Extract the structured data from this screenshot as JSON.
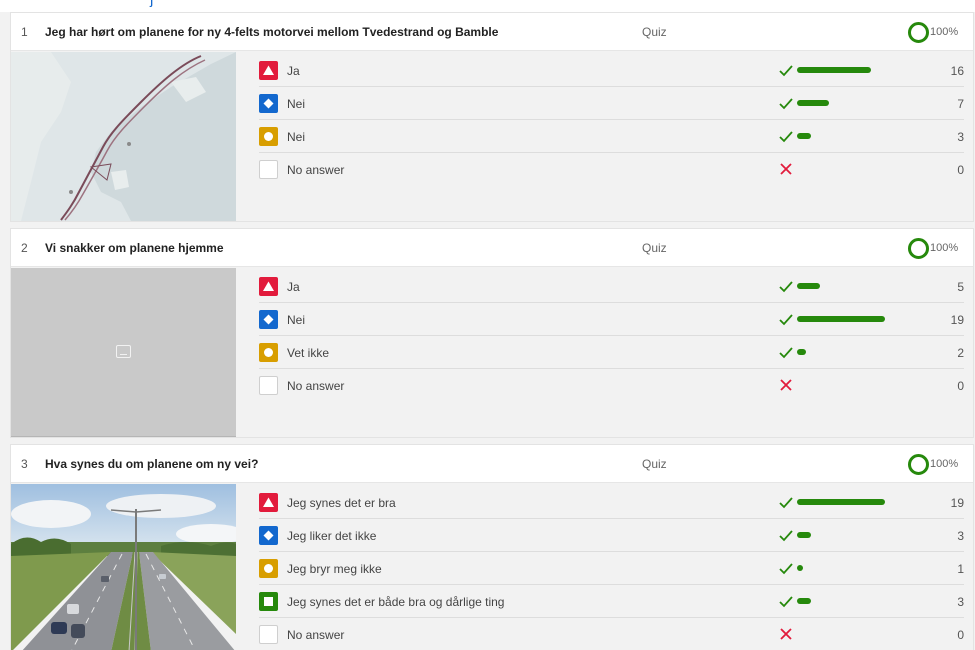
{
  "colors": {
    "correct": "#26890c",
    "wrong": "#e21b3c",
    "red": "#e21b3c",
    "blue": "#1368ce",
    "yellow": "#d89e00",
    "green": "#26890c"
  },
  "top_fragment": "j",
  "questions": [
    {
      "number": "1",
      "title": "Jeg har hørt om planene for ny 4-felts motorvei mellom Tvedestrand og Bamble",
      "type": "Quiz",
      "percent": "100%",
      "image": "map",
      "answers": [
        {
          "shape": "triangle-icon",
          "color": "red",
          "text": "Ja",
          "correct": true,
          "count": 16
        },
        {
          "shape": "diamond-icon",
          "color": "blue",
          "text": "Nei",
          "correct": true,
          "count": 7
        },
        {
          "shape": "circle-icon",
          "color": "yellow",
          "text": "Nei",
          "correct": true,
          "count": 3
        },
        {
          "shape": "none",
          "color": "none",
          "text": "No answer",
          "correct": false,
          "count": 0
        }
      ]
    },
    {
      "number": "2",
      "title": "Vi snakker om planene hjemme",
      "type": "Quiz",
      "percent": "100%",
      "image": "placeholder",
      "answers": [
        {
          "shape": "triangle-icon",
          "color": "red",
          "text": "Ja",
          "correct": true,
          "count": 5
        },
        {
          "shape": "diamond-icon",
          "color": "blue",
          "text": "Nei",
          "correct": true,
          "count": 19
        },
        {
          "shape": "circle-icon",
          "color": "yellow",
          "text": "Vet ikke",
          "correct": true,
          "count": 2
        },
        {
          "shape": "none",
          "color": "none",
          "text": "No answer",
          "correct": false,
          "count": 0
        }
      ]
    },
    {
      "number": "3",
      "title": "Hva synes du om planene om ny vei?",
      "type": "Quiz",
      "percent": "100%",
      "image": "highway",
      "answers": [
        {
          "shape": "triangle-icon",
          "color": "red",
          "text": "Jeg synes det er bra",
          "correct": true,
          "count": 19
        },
        {
          "shape": "diamond-icon",
          "color": "blue",
          "text": "Jeg liker det ikke",
          "correct": true,
          "count": 3
        },
        {
          "shape": "circle-icon",
          "color": "yellow",
          "text": "Jeg bryr meg ikke",
          "correct": true,
          "count": 1
        },
        {
          "shape": "square-icon",
          "color": "green",
          "text": "Jeg synes det er både bra og dårlige ting",
          "correct": true,
          "count": 3
        },
        {
          "shape": "none",
          "color": "none",
          "text": "No answer",
          "correct": false,
          "count": 0
        }
      ]
    }
  ]
}
